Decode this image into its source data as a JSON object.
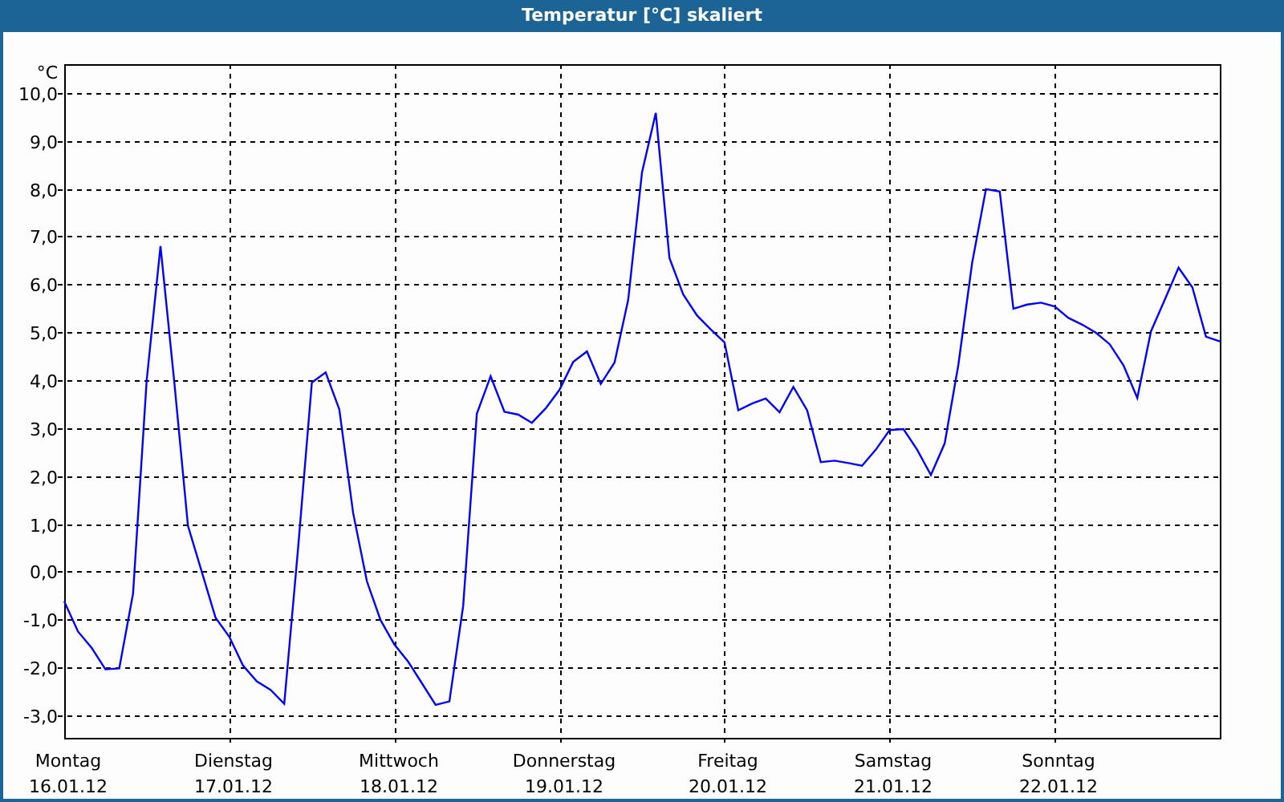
{
  "window": {
    "title": "Temperatur [°C] skaliert"
  },
  "chart_data": {
    "type": "line",
    "ylabel": "°C",
    "ylim": [
      -3.47,
      10.6
    ],
    "grid": true,
    "yticks": [
      {
        "value": -3,
        "label": "-3,0"
      },
      {
        "value": -2,
        "label": "-2,0"
      },
      {
        "value": -1,
        "label": "-1,0"
      },
      {
        "value": 0,
        "label": "0,0"
      },
      {
        "value": 1,
        "label": "1,0"
      },
      {
        "value": 2,
        "label": "2,0"
      },
      {
        "value": 3,
        "label": "3,0"
      },
      {
        "value": 4,
        "label": "4,0"
      },
      {
        "value": 5,
        "label": "5,0"
      },
      {
        "value": 6,
        "label": "6,0"
      },
      {
        "value": 7,
        "label": "7,0"
      },
      {
        "value": 8,
        "label": "8,0"
      },
      {
        "value": 9,
        "label": "9,0"
      },
      {
        "value": 10,
        "label": "10,0"
      }
    ],
    "categories": [
      "Montag\n16.01.12",
      null,
      null,
      null,
      null,
      null,
      null,
      null,
      null,
      null,
      null,
      null,
      "Dienstag\n17.01.12",
      null,
      null,
      null,
      null,
      null,
      null,
      null,
      null,
      null,
      null,
      null,
      "Mittwoch\n18.01.12",
      null,
      null,
      null,
      null,
      null,
      null,
      null,
      null,
      null,
      null,
      null,
      "Donnerstag\n19.01.12",
      null,
      null,
      null,
      null,
      null,
      null,
      null,
      null,
      null,
      null,
      null,
      "Freitag\n20.01.12",
      null,
      null,
      null,
      null,
      null,
      null,
      null,
      null,
      null,
      null,
      null,
      "Samstag\n21.01.12",
      null,
      null,
      null,
      null,
      null,
      null,
      null,
      null,
      null,
      null,
      null,
      "Sonntag\n22.01.12",
      null,
      null,
      null,
      null,
      null,
      null,
      null,
      null,
      null,
      null,
      null,
      null
    ],
    "series": [
      {
        "color": "#0000ff",
        "values": [
          -0.62,
          -1.25,
          -1.59,
          -2.04,
          -2.02,
          -0.46,
          4.0,
          6.8,
          3.96,
          0.96,
          0.0,
          -0.96,
          -1.36,
          -1.96,
          -2.29,
          -2.47,
          -2.76,
          0.48,
          3.95,
          4.16,
          3.39,
          1.23,
          -0.2,
          -1.01,
          -1.52,
          -1.88,
          -2.33,
          -2.78,
          -2.71,
          -0.71,
          3.3,
          4.08,
          3.34,
          3.28,
          3.11,
          3.41,
          3.8,
          4.38,
          4.6,
          3.92,
          4.37,
          5.68,
          8.34,
          9.58,
          6.55,
          5.79,
          5.35,
          5.06,
          4.79,
          3.37,
          3.51,
          3.62,
          3.33,
          3.86,
          3.37,
          2.29,
          2.32,
          2.27,
          2.21,
          2.55,
          2.96,
          2.98,
          2.55,
          2.02,
          2.68,
          4.32,
          6.45,
          7.99,
          7.94,
          5.49,
          5.58,
          5.62,
          5.54,
          5.3,
          5.16,
          4.99,
          4.75,
          4.31,
          3.63,
          5.02,
          5.68,
          6.35,
          5.94,
          4.91,
          4.81
        ]
      }
    ]
  }
}
